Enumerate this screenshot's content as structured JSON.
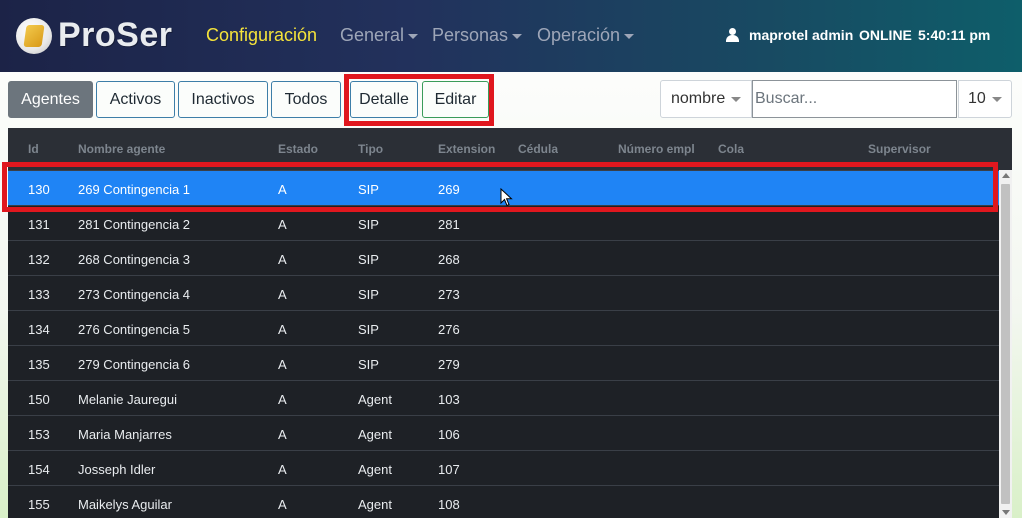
{
  "app": {
    "brand": "ProSer"
  },
  "nav": {
    "items": [
      {
        "label": "Configuración",
        "active": true,
        "dropdown": false
      },
      {
        "label": "General",
        "active": false,
        "dropdown": true
      },
      {
        "label": "Personas",
        "active": false,
        "dropdown": true
      },
      {
        "label": "Operación",
        "active": false,
        "dropdown": true
      }
    ],
    "user": "maprotel admin",
    "status": "ONLINE",
    "time": "5:40:11 pm"
  },
  "toolbar": {
    "filters": [
      "Agentes",
      "Activos",
      "Inactivos",
      "Todos"
    ],
    "active_filter": "Agentes",
    "actions": [
      "Detalle",
      "Editar"
    ],
    "search_field": "nombre",
    "search_placeholder": "Buscar...",
    "page_size": "10"
  },
  "table": {
    "columns": [
      "Id",
      "Nombre agente",
      "Estado",
      "Tipo",
      "Extension",
      "Cédula",
      "Número empl",
      "Cola",
      "Supervisor"
    ],
    "rows": [
      [
        "130",
        "269 Contingencia 1",
        "A",
        "SIP",
        "269",
        "",
        "",
        "",
        ""
      ],
      [
        "131",
        "281 Contingencia 2",
        "A",
        "SIP",
        "281",
        "",
        "",
        "",
        ""
      ],
      [
        "132",
        "268 Contingencia 3",
        "A",
        "SIP",
        "268",
        "",
        "",
        "",
        ""
      ],
      [
        "133",
        "273 Contingencia 4",
        "A",
        "SIP",
        "273",
        "",
        "",
        "",
        ""
      ],
      [
        "134",
        "276 Contingencia 5",
        "A",
        "SIP",
        "276",
        "",
        "",
        "",
        ""
      ],
      [
        "135",
        "279 Contingencia 6",
        "A",
        "SIP",
        "279",
        "",
        "",
        "",
        ""
      ],
      [
        "150",
        "Melanie Jauregui",
        "A",
        "Agent",
        "103",
        "",
        "",
        "",
        ""
      ],
      [
        "153",
        "Maria Manjarres",
        "A",
        "Agent",
        "106",
        "",
        "",
        "",
        ""
      ],
      [
        "154",
        "Josseph Idler",
        "A",
        "Agent",
        "107",
        "",
        "",
        "",
        ""
      ],
      [
        "155",
        "Maikelys Aguilar",
        "A",
        "Agent",
        "108",
        "",
        "",
        "",
        ""
      ]
    ],
    "selected_row": 0
  },
  "colors": {
    "accent": "#f5e33a",
    "selected_row": "#1f84f5",
    "highlight": "#e0171e",
    "grid_bg": "#1e2126"
  },
  "icons": {
    "user": "user-icon",
    "dropdown": "chevron-down-icon",
    "cursor": "mouse-pointer-icon"
  }
}
